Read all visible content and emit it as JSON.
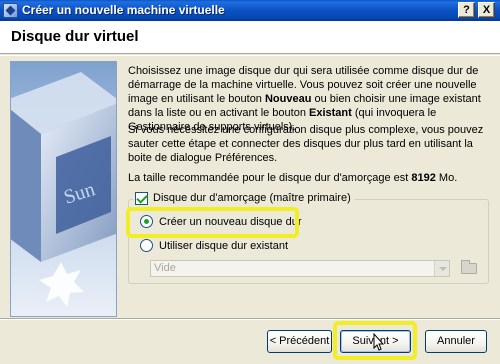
{
  "window": {
    "title": "Créer un nouvelle machine virtuelle",
    "help_label": "?",
    "close_label": "X"
  },
  "header": {
    "title": "Disque dur virtuel"
  },
  "description": {
    "p1_a": "Choisissez une image disque dur qui sera utilisée comme disque dur de démarrage de la machine virtuelle. Vous pouvez soit créer une nouvelle image en utilisant le bouton ",
    "p1_b": "Nouveau",
    "p1_c": " ou bien choisir une image existant dans la liste ou en activant le bouton ",
    "p1_d": "Existant",
    "p1_e": " (qui invoquera le Gestionnaire de supports virtuels).",
    "p2": "Si vous nécéssitez une configuration disque plus complexe, vous pouvez sauter cette étape et connecter des disques dur plus tard en utilisant la boite de dialogue Préférences.",
    "p3_a": "La taille recommandée pour le disque dur d'amorçage est ",
    "p3_b": "8192",
    "p3_c": " Mo."
  },
  "boot_disk": {
    "checkbox_label": "Disque dur d'amorçage (maître primaire)",
    "checked": true,
    "options": [
      {
        "label": "Créer un nouveau disque dur",
        "selected": true
      },
      {
        "label": "Utiliser disque dur existant",
        "selected": false
      }
    ],
    "existing_value": "Vide"
  },
  "footer": {
    "back_label": "< Précédent",
    "next_label": "Suivant >",
    "cancel_label": "Annuler"
  },
  "colors": {
    "highlight": "#f2ee25",
    "titlebar": "#0c52c4"
  }
}
